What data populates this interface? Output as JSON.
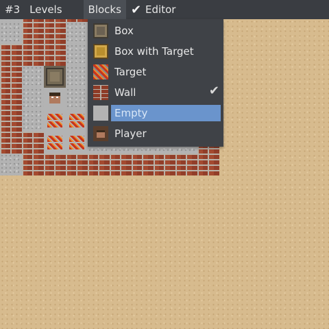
{
  "menubar": {
    "level_label": "#3",
    "levels_label": "Levels",
    "blocks_label": "Blocks",
    "editor_label": "Editor",
    "editor_checked": true
  },
  "blocks_menu": {
    "items": [
      {
        "label": "Box",
        "icon": "box-icon"
      },
      {
        "label": "Box with Target",
        "icon": "box-with-target-icon"
      },
      {
        "label": "Target",
        "icon": "target-icon"
      },
      {
        "label": "Wall",
        "icon": "wall-icon",
        "checked": true
      },
      {
        "label": "Empty",
        "icon": "empty-icon",
        "highlighted": true
      },
      {
        "label": "Player",
        "icon": "player-icon"
      }
    ]
  },
  "board": {
    "legend": {
      "W": "wall",
      ".": "floor",
      "T": "target",
      "B": "box",
      "P": "player",
      " ": "outside"
    },
    "rows": [
      ".WWWWWWWW.",
      ".WW....WW.",
      "WWW......W",
      "W.B.W..WWW",
      "W.P....W.W",
      "W.TT....WW",
      "WWTT.....W",
      ".WWWWWWWWW"
    ]
  },
  "colors": {
    "menubar_bg": "#3a3d42",
    "menu_bg": "#3f4247",
    "highlight": "#6a94cc",
    "sand": "#d7bb8e"
  }
}
